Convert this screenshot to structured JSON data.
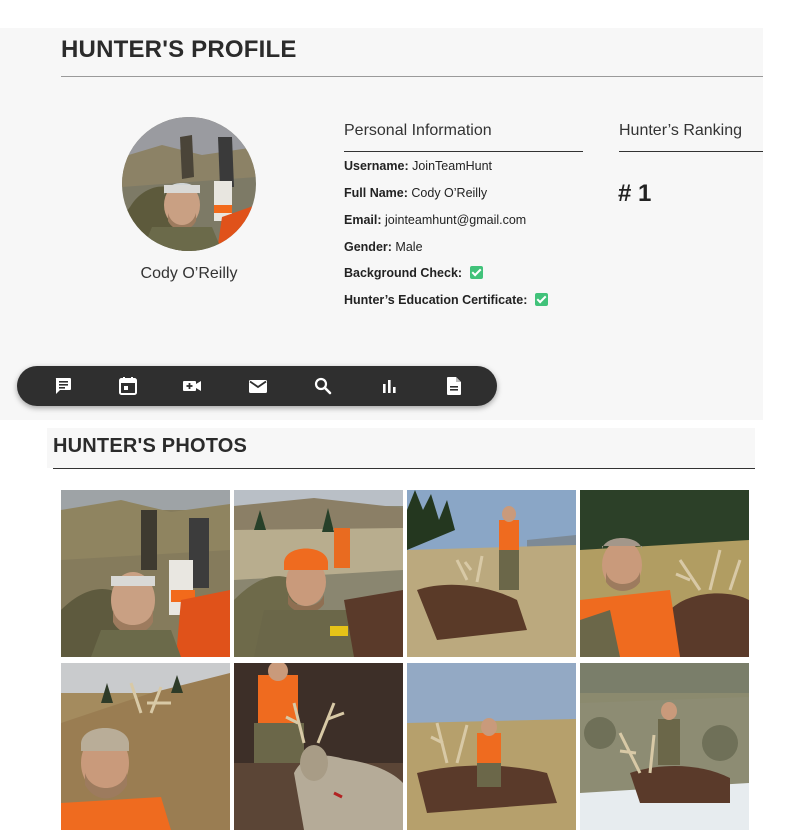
{
  "profile": {
    "title": "HUNTER'S PROFILE",
    "avatar_name": "Cody O’Reilly"
  },
  "personal_info": {
    "heading": "Personal Information",
    "fields": [
      {
        "label": "Username:",
        "value": "JoinTeamHunt"
      },
      {
        "label": "Full Name:",
        "value": "Cody O’Reilly"
      },
      {
        "label": "Email:",
        "value": "jointeamhunt@gmail.com"
      },
      {
        "label": "Gender:",
        "value": "Male"
      },
      {
        "label": "Background Check:",
        "value": ""
      },
      {
        "label": "Hunter’s Education Certificate:",
        "value": ""
      }
    ]
  },
  "ranking": {
    "heading": "Hunter’s Ranking",
    "value": "# 1"
  },
  "toolbar": {
    "icons": [
      "message-icon",
      "calendar-icon",
      "video-call-icon",
      "mail-icon",
      "search-icon",
      "bar-chart-icon",
      "document-icon"
    ]
  },
  "photos": {
    "title": "HUNTER'S PHOTOS",
    "count": 8
  },
  "colors": {
    "panel_bg": "#f7f7f7",
    "toolbar_bg": "#2f2f2f",
    "check_green": "#41c27a",
    "blaze_orange": "#f26a1b"
  }
}
